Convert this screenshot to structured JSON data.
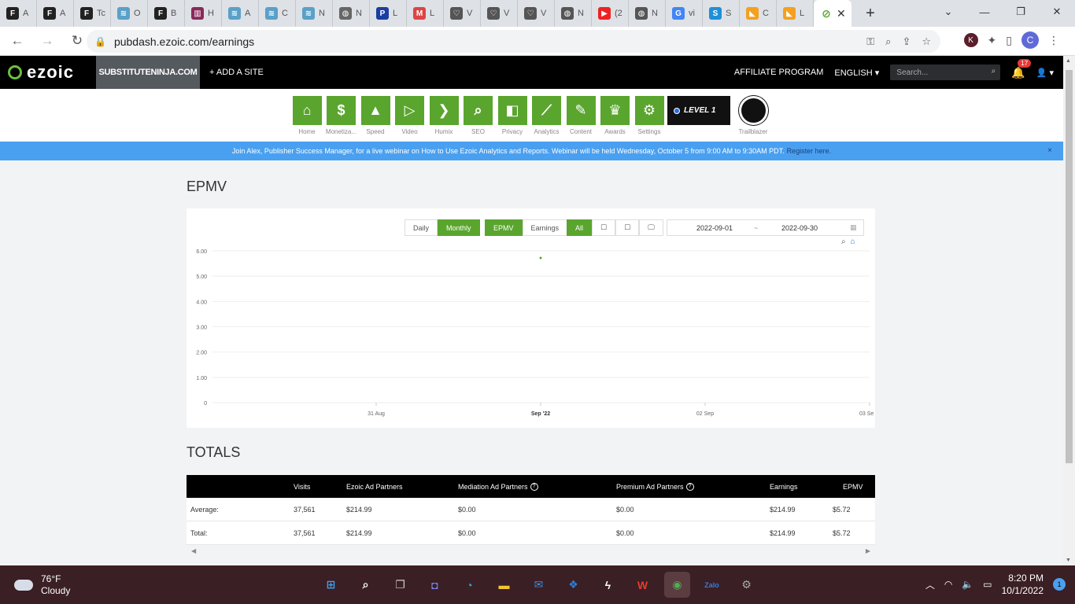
{
  "browser": {
    "tabs": [
      {
        "fav": "F",
        "label": "A",
        "color": "#222"
      },
      {
        "fav": "F",
        "label": "A",
        "color": "#222"
      },
      {
        "fav": "F",
        "label": "Tc",
        "color": "#222"
      },
      {
        "fav": "≋",
        "label": "O",
        "color": "#5aa0c8"
      },
      {
        "fav": "F",
        "label": "B",
        "color": "#222"
      },
      {
        "fav": "▥",
        "label": "H",
        "color": "#8a2a5a"
      },
      {
        "fav": "≋",
        "label": "A",
        "color": "#5aa0c8"
      },
      {
        "fav": "≋",
        "label": "C",
        "color": "#5aa0c8"
      },
      {
        "fav": "≋",
        "label": "N",
        "color": "#5aa0c8"
      },
      {
        "fav": "◍",
        "label": "N",
        "color": "#666"
      },
      {
        "fav": "P",
        "label": "L",
        "color": "#1a3fa0"
      },
      {
        "fav": "M",
        "label": "L",
        "color": "#d44"
      },
      {
        "fav": "♡",
        "label": "V",
        "color": "#555"
      },
      {
        "fav": "♡",
        "label": "V",
        "color": "#555"
      },
      {
        "fav": "♡",
        "label": "V",
        "color": "#555"
      },
      {
        "fav": "◍",
        "label": "N",
        "color": "#555"
      },
      {
        "fav": "▶",
        "label": "(2",
        "color": "#e22"
      },
      {
        "fav": "◍",
        "label": "N",
        "color": "#555"
      },
      {
        "fav": "G",
        "label": "vi",
        "color": "#4285f4"
      },
      {
        "fav": "S",
        "label": "S",
        "color": "#1f8fd8"
      },
      {
        "fav": "◣",
        "label": "C",
        "color": "#f4a020"
      },
      {
        "fav": "◣",
        "label": "L",
        "color": "#f4a020"
      }
    ],
    "active_tab_fav": "⊘",
    "new_tab": "+",
    "url": "pubdash.ezoic.com/earnings",
    "profile_initial": "C",
    "ext_initial": "K"
  },
  "header": {
    "logo": "ezoic",
    "site": "SUBSTITUTENINJA.COM",
    "add_site": "+ ADD A SITE",
    "affiliate": "AFFILIATE PROGRAM",
    "language": "ENGLISH ▾",
    "search_placeholder": "Search...",
    "notif_count": "17"
  },
  "nav": [
    {
      "label": "Home",
      "icon": "⌂",
      "name": "home"
    },
    {
      "label": "Monetiza...",
      "icon": "$",
      "name": "monetization"
    },
    {
      "label": "Speed",
      "icon": "▲",
      "name": "speed"
    },
    {
      "label": "Video",
      "icon": "▷",
      "name": "video"
    },
    {
      "label": "Humix",
      "icon": "❯",
      "name": "humix"
    },
    {
      "label": "SEO",
      "icon": "⌕",
      "name": "seo"
    },
    {
      "label": "Privacy",
      "icon": "◧",
      "name": "privacy"
    },
    {
      "label": "Analytics",
      "icon": "⟋",
      "name": "analytics"
    },
    {
      "label": "Content",
      "icon": "✎",
      "name": "content"
    },
    {
      "label": "Awards",
      "icon": "♛",
      "name": "awards"
    },
    {
      "label": "Settings",
      "icon": "⚙",
      "name": "settings"
    }
  ],
  "level": "LEVEL 1",
  "trailblazer": "Trailblazer",
  "banner": {
    "text": "Join Alex, Publisher Success Manager, for a live webinar on How to Use Ezoic Analytics and Reports. Webinar will be held Wednesday, October 5 from 9:00 AM to 9:30AM PDT.",
    "link": "Register here.",
    "close": "×"
  },
  "page_title": "EPMV",
  "controls": {
    "period": [
      "Daily",
      "Monthly"
    ],
    "metric": [
      "EPMV",
      "Earnings"
    ],
    "device": [
      "All",
      "☐",
      "☐",
      "🖵"
    ],
    "date_from": "2022-09-01",
    "date_sep": "~",
    "date_to": "2022-09-30"
  },
  "chart_data": {
    "type": "scatter",
    "yticks": [
      "6.00",
      "5.00",
      "4.00",
      "3.00",
      "2.00",
      "1.00",
      "0"
    ],
    "xticks": [
      "31 Aug",
      "Sep '22",
      "02 Sep",
      "03 Se"
    ],
    "ylim": [
      0,
      6
    ],
    "points": [
      {
        "x": "Sep '22",
        "y": 5.72
      }
    ],
    "color": "#5aa52e"
  },
  "totals_title": "TOTALS",
  "table": {
    "headers": [
      "",
      "Visits",
      "Ezoic Ad Partners",
      "Mediation Ad Partners",
      "Premium Ad Partners",
      "Earnings",
      "EPMV"
    ],
    "rows": [
      [
        "Average:",
        "37,561",
        "$214.99",
        "$0.00",
        "$0.00",
        "$214.99",
        "$5.72"
      ],
      [
        "Total:",
        "37,561",
        "$214.99",
        "$0.00",
        "$0.00",
        "$214.99",
        "$5.72"
      ]
    ]
  },
  "taskbar": {
    "temp": "76°F",
    "condition": "Cloudy",
    "time": "8:20 PM",
    "date": "10/1/2022",
    "notifications": "1"
  }
}
